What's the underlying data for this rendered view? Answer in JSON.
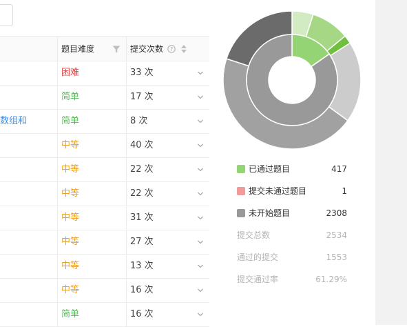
{
  "search": {
    "icon": "search-icon"
  },
  "table": {
    "headers": {
      "difficulty": "题目难度",
      "submissions": "提交次数"
    },
    "rows": [
      {
        "title": "",
        "difficulty": "困难",
        "level": "hard",
        "submissions": "33 次"
      },
      {
        "title": "",
        "difficulty": "简单",
        "level": "easy",
        "submissions": "17 次"
      },
      {
        "title": "数组和",
        "difficulty": "简单",
        "level": "easy",
        "submissions": "8 次"
      },
      {
        "title": "",
        "difficulty": "中等",
        "level": "medium",
        "submissions": "40 次"
      },
      {
        "title": "",
        "difficulty": "中等",
        "level": "medium",
        "submissions": "22 次"
      },
      {
        "title": "",
        "difficulty": "中等",
        "level": "medium",
        "submissions": "22 次"
      },
      {
        "title": "",
        "difficulty": "中等",
        "level": "medium",
        "submissions": "31 次"
      },
      {
        "title": "",
        "difficulty": "中等",
        "level": "medium",
        "submissions": "27 次"
      },
      {
        "title": "",
        "difficulty": "中等",
        "level": "medium",
        "submissions": "13 次"
      },
      {
        "title": "",
        "difficulty": "中等",
        "level": "medium",
        "submissions": "16 次"
      },
      {
        "title": "",
        "difficulty": "简单",
        "level": "easy",
        "submissions": "16 次"
      }
    ]
  },
  "colors": {
    "hard": "#e54545",
    "easy": "#5cb85c",
    "medium": "#f0a020",
    "passed": "#95d475",
    "failed": "#f19a9a",
    "not_started": "#999999"
  },
  "legend": [
    {
      "label": "已通过题目",
      "value": "417",
      "color": "#95d475"
    },
    {
      "label": "提交未通过题目",
      "value": "1",
      "color": "#f19a9a"
    },
    {
      "label": "未开始题目",
      "value": "2308",
      "color": "#999999"
    }
  ],
  "stats": [
    {
      "label": "提交总数",
      "value": "2534"
    },
    {
      "label": "通过的提交",
      "value": "1553"
    },
    {
      "label": "提交通过率",
      "value": "61.29%"
    }
  ],
  "chart_data": {
    "type": "pie",
    "inner_ring": [
      {
        "name": "已通过题目",
        "value": 417,
        "color": "#95d475"
      },
      {
        "name": "提交未通过题目",
        "value": 1,
        "color": "#f19a9a"
      },
      {
        "name": "未开始题目",
        "value": 2308,
        "color": "#999999"
      }
    ],
    "outer_ring": [
      {
        "value": 0.05,
        "color": "#d3ebc3"
      },
      {
        "value": 0.09,
        "color": "#a6d784"
      },
      {
        "value": 0.02,
        "color": "#70c040"
      },
      {
        "value": 0.19,
        "color": "#cccccc"
      },
      {
        "value": 0.45,
        "color": "#a1a1a1"
      },
      {
        "value": 0.2,
        "color": "#6b6b6b"
      }
    ]
  }
}
